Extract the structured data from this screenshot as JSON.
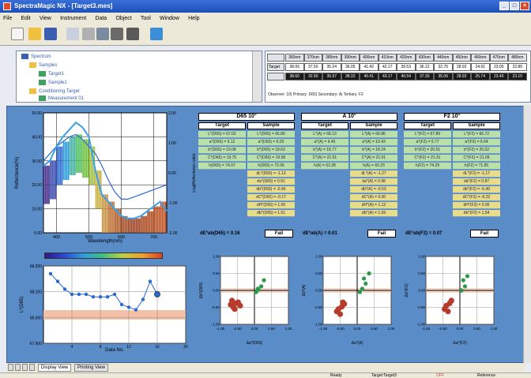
{
  "window": {
    "title": "SpectraMagic NX - [Target3.mes]"
  },
  "menu": [
    "File",
    "Edit",
    "View",
    "Instrument",
    "Data",
    "Object",
    "Tool",
    "Window",
    "Help"
  ],
  "tree": {
    "items": [
      {
        "label": "Spectrum",
        "level": 0
      },
      {
        "label": "Samples",
        "level": 1
      },
      {
        "label": "Target1",
        "level": 2
      },
      {
        "label": "Sample1",
        "level": 2
      },
      {
        "label": "Conditioning Target",
        "level": 1
      },
      {
        "label": "Measurement 01",
        "level": 2
      }
    ]
  },
  "grid": {
    "columns": [
      "360nm",
      "370nm",
      "380nm",
      "390nm",
      "400nm",
      "410nm",
      "420nm",
      "430nm",
      "440nm",
      "450nm",
      "460nm",
      "470nm",
      "480nm"
    ],
    "rows": [
      {
        "label": "Target",
        "values": [
          "38.06",
          "37.50",
          "35.24",
          "36.05",
          "41.42",
          "42.17",
          "39.53",
          "36.12",
          "32.75",
          "28.92",
          "24.91",
          "23.05",
          "22.80"
        ]
      },
      {
        "label": "",
        "values": [
          "38.60",
          "32.90",
          "35.97",
          "38.32",
          "40.41",
          "43.17",
          "40.54",
          "37.30",
          "35.06",
          "28.92",
          "25.74",
          "23.40",
          "23.10"
        ]
      }
    ],
    "status": "Observer: 10|  Primary: D65|  Secondary: A|  Tertiary: F2"
  },
  "main": {
    "panels": [
      {
        "title": "D65 10°",
        "target_header": "Target",
        "sample_header": "Sample",
        "target": [
          "L*(D65) = 67.02",
          "a*(D65) = 5.12",
          "b*(D65) = 19.08",
          "C*(D65) = 19.75",
          "h(D65) = 74.97"
        ],
        "sample": [
          "L*(D65) = 65.89",
          "a*(D65) = 6.03",
          "b*(D65) = 18.63",
          "C*(D65) = 19.58",
          "h(D65) = 72.06",
          "dL*(D65) = -1.13",
          "da*(D65) = 0.91",
          "db*(D65) = -0.45",
          "dC*(D65) = -0.17",
          "dH*(D65) = 1.00",
          "dE*(D65) = 1.51"
        ],
        "de_label": "dE*ab(D65) = 0.16",
        "de_result": "Fail"
      },
      {
        "title": "A 10°",
        "target_header": "Target",
        "sample_header": "Sample",
        "target": [
          "L*(A) = 68.13",
          "a*(A) = 9.45",
          "b*(A) = 18.77",
          "C*(A) = 21.01",
          "h(A) = 63.28"
        ],
        "sample": [
          "L*(A) = 66.86",
          "a*(A) = 10.43",
          "b*(A) = 18.24",
          "C*(A) = 21.01",
          "h(A) = 60.23",
          "dL*(A) = -1.27",
          "da*(A) = 0.98",
          "db*(A) = -0.53",
          "dC*(A) = 0.00",
          "dH*(A) = 1.12",
          "dE*(A) = 1.69"
        ],
        "de_label": "dE*ab(A) = 0.01",
        "de_result": "Fail"
      },
      {
        "title": "F2 10°",
        "target_header": "Target",
        "sample_header": "Sample",
        "target": [
          "L*(F2) = 67.89",
          "a*(F2) = 5.77",
          "b*(F2) = 20.51",
          "C*(F2) = 21.31",
          "h(F2) = 74.29"
        ],
        "sample": [
          "L*(F2) = 66.72",
          "a*(F2) = 6.64",
          "b*(F2) = 20.02",
          "C*(F2) = 21.09",
          "h(F2) = 71.65",
          "dL*(F2) = -1.17",
          "da*(F2) = 0.87",
          "db*(F2) = -0.49",
          "dC*(F2) = -0.22",
          "dH*(F2) = 0.95",
          "dE*(F2) = 1.54"
        ],
        "de_label": "dE*ab(F2) = 0.07",
        "de_result": "Fail"
      }
    ]
  },
  "chart_data": [
    {
      "type": "line",
      "xlabel": "Wavelength(nm)",
      "ylabel": "Reflectance(%)",
      "y2label": "Log(Reflectance ratio)",
      "xlim": [
        360,
        740
      ],
      "ylim": [
        0,
        50
      ],
      "y2lim": [
        -2.0,
        2.0
      ],
      "xticks": [
        400,
        500,
        600,
        700
      ],
      "xtick_labels": [
        "400",
        "500",
        "600",
        "700"
      ],
      "yticks": [
        0,
        10,
        20,
        30,
        40,
        50
      ],
      "ytick_labels": [
        "0.00",
        "10.00",
        "20.00",
        "30.00",
        "40.00",
        "50.00"
      ],
      "y2ticks": [
        -2,
        -1,
        0,
        1,
        2
      ],
      "y2tick_labels": [
        "-2.00",
        "-1.00",
        "0.00",
        "1.00",
        "2.00"
      ],
      "series": [
        {
          "x": [
            360,
            380,
            400,
            420,
            440,
            460,
            480,
            500,
            520,
            540,
            560,
            580,
            600,
            620,
            640,
            660,
            680,
            700,
            720,
            740
          ],
          "y": [
            30,
            33,
            36,
            38,
            40,
            41,
            39,
            36,
            33,
            28,
            22,
            17,
            14,
            14,
            15,
            16,
            17,
            18,
            19,
            20
          ]
        },
        {
          "x": [
            360,
            380,
            400,
            420,
            440,
            460,
            480,
            500,
            520,
            540,
            560,
            580,
            600,
            620,
            640,
            660,
            680,
            700,
            720,
            740
          ],
          "y": [
            28,
            30,
            36,
            40,
            43,
            46,
            44,
            40,
            26,
            16,
            13,
            10,
            7,
            6,
            6,
            7,
            9,
            11,
            13,
            9
          ]
        }
      ]
    },
    {
      "type": "line",
      "xlabel": "Data No.",
      "ylabel": "L*(D65)",
      "xlim": [
        0,
        20
      ],
      "ylim": [
        67.9,
        68.2
      ],
      "xticks": [
        4,
        8,
        12,
        16,
        20
      ],
      "yticks": [
        67.9,
        68.0,
        68.1,
        68.2
      ],
      "ytick_labels": [
        "67.900",
        "68.000",
        "68.100",
        "68.200"
      ],
      "series": [
        {
          "x": [
            1,
            2,
            3,
            4,
            5,
            6,
            7,
            8,
            9,
            10,
            11,
            12,
            13,
            14,
            15,
            16
          ],
          "y": [
            68.17,
            68.14,
            68.11,
            68.09,
            68.09,
            68.09,
            68.08,
            68.08,
            68.08,
            68.09,
            68.05,
            68.04,
            68.03,
            68.07,
            68.14,
            68.09
          ]
        }
      ]
    },
    {
      "type": "scatter",
      "xlabel": "Δa*(D65)",
      "ylabel": "Δb*(D65)",
      "xlim": [
        -1,
        1
      ],
      "ylim": [
        -1,
        1
      ],
      "xticks": [
        -1,
        -0.5,
        0,
        0.5,
        1
      ],
      "xtick_labels": [
        "-1.00",
        "-0.50",
        "0.00",
        "0.50",
        "1.00"
      ],
      "yticks": [
        -1,
        -0.5,
        0,
        0.5,
        1
      ],
      "ytick_labels": [
        "-1.00",
        "-0.50",
        "0.00",
        "0.50",
        "1.00"
      ],
      "series": [
        {
          "x": [
            -0.7,
            -0.55,
            -0.62,
            -0.48,
            -0.66,
            -0.42,
            -0.58
          ],
          "y": [
            -0.42,
            -0.38,
            -0.5,
            -0.35,
            -0.3,
            -0.45,
            -0.55
          ]
        },
        {
          "x": [
            0.05,
            0.12,
            0.2,
            0.28,
            0.1
          ],
          "y": [
            -0.05,
            0.02,
            0.12,
            0.3,
            0.05
          ]
        }
      ]
    },
    {
      "type": "scatter",
      "xlabel": "Δa*(A)",
      "ylabel": "Δb*(A)",
      "xlim": [
        -1,
        1
      ],
      "ylim": [
        -1,
        1
      ],
      "xticks": [
        -1,
        -0.5,
        0,
        0.5,
        1
      ],
      "xtick_labels": [
        "-1.00",
        "-0.50",
        "0.00",
        "0.50",
        "1.00"
      ],
      "yticks": [
        -1,
        -0.5,
        0,
        0.5,
        1
      ],
      "ytick_labels": [
        "-1.00",
        "-0.50",
        "0.00",
        "0.50",
        "1.00"
      ],
      "series": [
        {
          "x": [
            -0.55,
            -0.45,
            -0.6,
            -0.38,
            -0.5,
            -0.42
          ],
          "y": [
            -0.55,
            -0.48,
            -0.62,
            -0.4,
            -0.7,
            -0.35
          ]
        },
        {
          "x": [
            0.08,
            0.15,
            0.25,
            0.2,
            0.35
          ],
          "y": [
            -0.05,
            0.05,
            0.2,
            0.35,
            0.5
          ]
        }
      ]
    },
    {
      "type": "scatter",
      "xlabel": "Δa*(F2)",
      "ylabel": "Δb*(F2)",
      "xlim": [
        -1,
        1
      ],
      "ylim": [
        -1,
        1
      ],
      "xticks": [
        -1,
        -0.5,
        0,
        0.5,
        1
      ],
      "xtick_labels": [
        "-1.00",
        "-0.50",
        "0.00",
        "0.50",
        "1.00"
      ],
      "yticks": [
        -1,
        -0.5,
        0,
        0.5,
        1
      ],
      "ytick_labels": [
        "-1.00",
        "-0.50",
        "0.00",
        "0.50",
        "1.00"
      ],
      "series": [
        {
          "x": [
            -0.4,
            -0.3,
            -0.45,
            -0.25,
            -0.35
          ],
          "y": [
            -0.45,
            -0.38,
            -0.55,
            -0.3,
            -0.62
          ]
        },
        {
          "x": [
            0.05,
            0.15,
            0.1,
            0.22
          ],
          "y": [
            0.0,
            0.12,
            0.3,
            0.42
          ]
        }
      ]
    }
  ],
  "tabs": [
    "Display View",
    "Printing View"
  ],
  "statusbar": [
    "Ready",
    "Target:Target3",
    "OFF",
    "Reference"
  ],
  "colors": {
    "main_bg": "#5a8cc8",
    "green_cell": "#b8e0a8",
    "yellow_cell": "#e6dc8c",
    "target_series": "#3a8fd8",
    "sample_series": "#3a8fd8",
    "fail": "#000000"
  }
}
